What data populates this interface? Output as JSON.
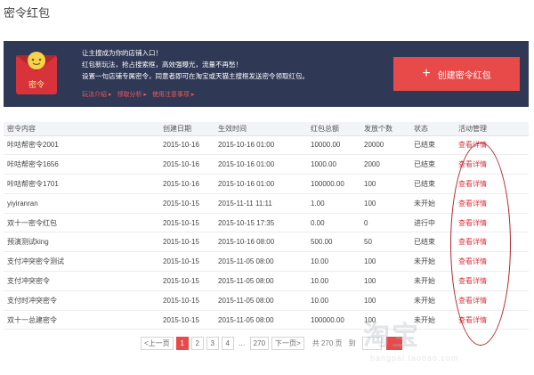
{
  "page_title": "密令红包",
  "banner": {
    "logo_text": "密令",
    "lines": [
      "让主搜成为你的店铺入口！",
      "红包新玩法，抢占搜索框，高效强曝光，流量不再愁！",
      "设置一句店铺专属密令，同意者即可在淘宝或天猫主搜框发送密令领取红包。"
    ],
    "links": [
      "玩法介绍 ▸",
      "领取分析 ▸",
      "使用注意事项 ▸"
    ],
    "create_button": "创建密令红包",
    "colors": {
      "background": "#2f3855",
      "accent": "#e84a4a"
    }
  },
  "table": {
    "headers": [
      "密令内容",
      "创建日期",
      "生效时间",
      "红包总额",
      "发放个数",
      "状态",
      "活动管理"
    ],
    "rows": [
      {
        "name": "咔咕帮密令2001",
        "created": "2015-10-16",
        "effective": "2015-10-16 01:00",
        "amount": "10000.00",
        "count": "20000",
        "status": "已结束",
        "action": "查看详情"
      },
      {
        "name": "咔咕帮密令1656",
        "created": "2015-10-16",
        "effective": "2015-10-16 01:00",
        "amount": "1000.00",
        "count": "2000",
        "status": "已结束",
        "action": "查看详情"
      },
      {
        "name": "咔咕帮密令1701",
        "created": "2015-10-16",
        "effective": "2015-10-16 01:00",
        "amount": "100000.00",
        "count": "100",
        "status": "已结束",
        "action": "查看详情"
      },
      {
        "name": "yiyiranran",
        "created": "2015-10-15",
        "effective": "2015-11-11 11:11",
        "amount": "1.00",
        "count": "100",
        "status": "未开始",
        "action": "查看详情"
      },
      {
        "name": "双十一密令红包",
        "created": "2015-10-15",
        "effective": "2015-10-15 17:35",
        "amount": "0.00",
        "count": "0",
        "status": "进行中",
        "action": "查看详情"
      },
      {
        "name": "预演测试king",
        "created": "2015-10-15",
        "effective": "2015-10-16 08:00",
        "amount": "500.00",
        "count": "50",
        "status": "已结束",
        "action": "查看详情"
      },
      {
        "name": "支付冲突密令测试",
        "created": "2015-10-15",
        "effective": "2015-11-05 08:00",
        "amount": "10.00",
        "count": "100",
        "status": "未开始",
        "action": "查看详情"
      },
      {
        "name": "支付冲突密令",
        "created": "2015-10-15",
        "effective": "2015-11-05 08:00",
        "amount": "10.00",
        "count": "100",
        "status": "未开始",
        "action": "查看详情"
      },
      {
        "name": "支付时冲突密令",
        "created": "2015-10-15",
        "effective": "2015-11-05 08:00",
        "amount": "10.00",
        "count": "100",
        "status": "未开始",
        "action": "查看详情"
      },
      {
        "name": "双十一总建密令",
        "created": "2015-10-15",
        "effective": "2015-11-05 08:00",
        "amount": "100000.00",
        "count": "100",
        "status": "未开始",
        "action": "查看详情"
      }
    ]
  },
  "pagination": {
    "prev": "<上一页",
    "pages": [
      "1",
      "2",
      "3",
      "4"
    ],
    "ellipsis": "…",
    "last": "270",
    "next": "下一页>",
    "total": "共 270 页",
    "jump_label": "到"
  },
  "watermark": {
    "main": "淘宝",
    "sub": "bangpai.taobao.com"
  }
}
